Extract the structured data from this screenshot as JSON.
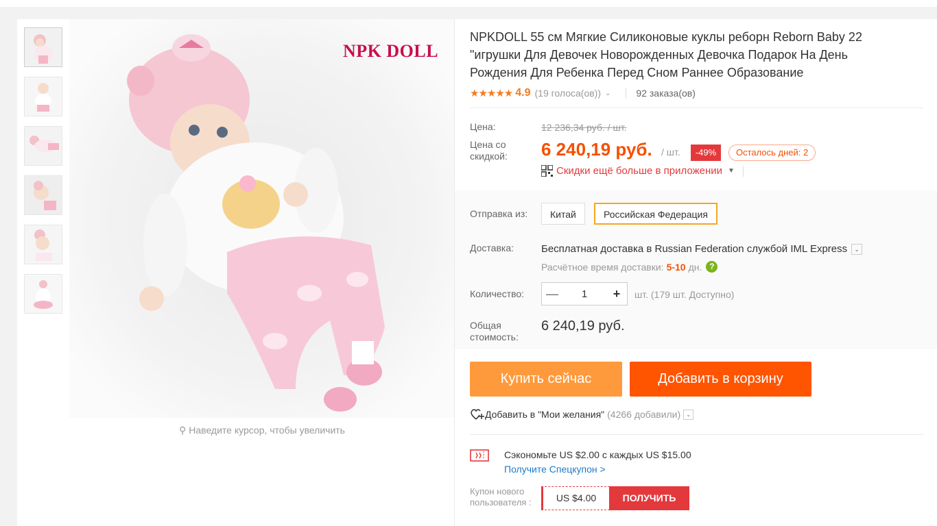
{
  "gallery": {
    "thumbnails": [
      "thumb-1",
      "thumb-2",
      "thumb-3",
      "thumb-4",
      "thumb-5",
      "thumb-6"
    ],
    "brand_logo": "NPK DOLL",
    "zoom_hint": "Наведите курсор, чтобы увеличить",
    "zoom_icon": "search-icon"
  },
  "product": {
    "title": "NPKDOLL 55 см Мягкие Силиконовые куклы реборн Reborn Baby 22 \"игрушки Для Девочек Новорожденных Девочка Подарок На День Рождения Для Ребенка Перед Сном Раннее Образование",
    "stars": "★★★★★",
    "rating": "4.9",
    "votes": "(19 голоса(ов))",
    "orders": "92 заказа(ов)"
  },
  "pricing": {
    "price_label": "Цена:",
    "old_price": "12 236,34 руб. / шт.",
    "discount_label": "Цена со скидкой:",
    "price": "6 240,19 руб.",
    "per_unit": "/ шт.",
    "discount_badge": "-49%",
    "days_left": "Осталось дней: 2",
    "app_discount": "Скидки ещё больше в приложении"
  },
  "shipping": {
    "from_label": "Отправка из:",
    "options": [
      "Китай",
      "Российская Федерация"
    ],
    "selected": "Российская Федерация",
    "delivery_label": "Доставка:",
    "delivery_text": "Бесплатная доставка в Russian Federation службой IML Express",
    "eta_label": "Расчётное время доставки:",
    "eta_days": "5-10",
    "eta_unit": "дн."
  },
  "quantity": {
    "label": "Количество:",
    "value": "1",
    "available": "шт. (179 шт. Доступно)"
  },
  "total": {
    "label": "Общая стоимость:",
    "value": "6 240,19 руб."
  },
  "actions": {
    "buy_now": "Купить сейчас",
    "add_to_cart": "Добавить в корзину",
    "wishlist": "Добавить в \"Мои желания\"",
    "wishlist_count": "(4266 добавили)"
  },
  "coupons": {
    "save_text": "Сэкономьте US $2.00 с каждых US $15.00",
    "get_special": "Получите Спецкупон >",
    "new_user_label": "Купон нового пользователя :",
    "coupon_value": "US $4.00",
    "get_button": "ПОЛУЧИТЬ"
  },
  "colors": {
    "accent_orange": "#ff5400",
    "buy_orange": "#ff9a3c",
    "price": "#f55000",
    "red": "#e4393c",
    "rating": "#f47a20",
    "link": "#1a7acc"
  }
}
